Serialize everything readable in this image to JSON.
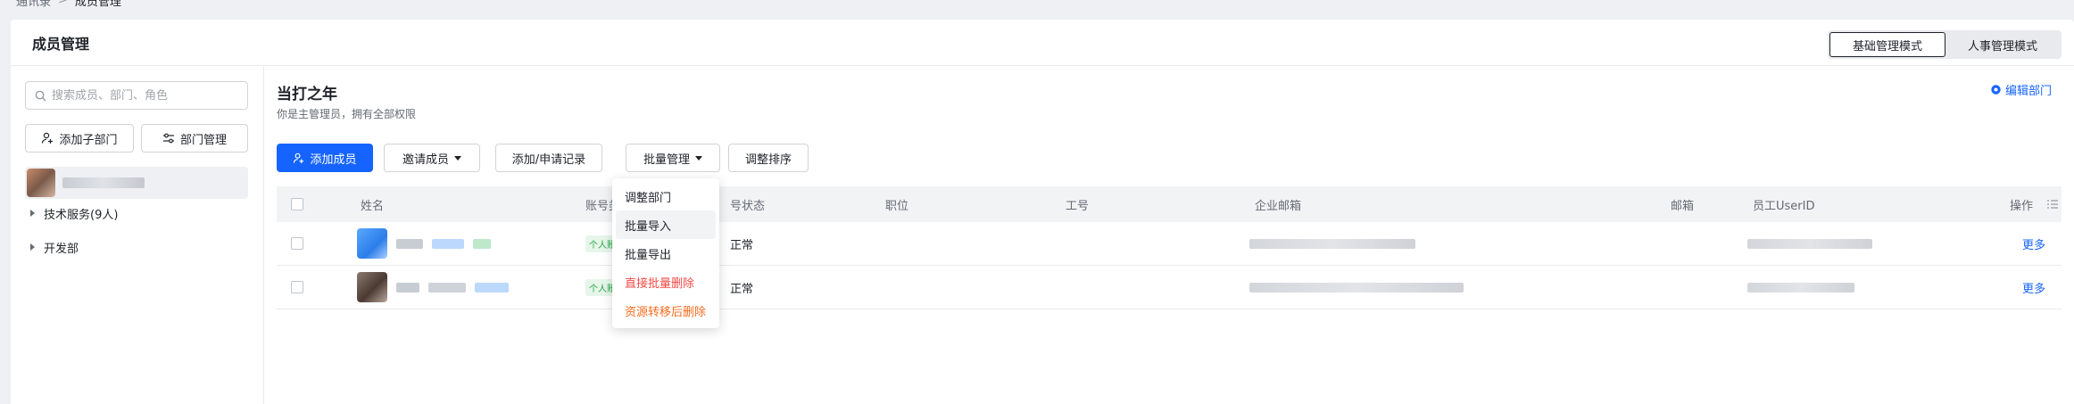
{
  "breadcrumb": {
    "parent": "通讯录",
    "separator": ">",
    "current": "成员管理"
  },
  "panel": {
    "title": "成员管理"
  },
  "mode_switch": {
    "basic": "基础管理模式",
    "hr": "人事管理模式",
    "active": "basic"
  },
  "sidebar": {
    "search_placeholder": "搜索成员、部门、角色",
    "add_sub_dept": "添加子部门",
    "dept_manage": "部门管理",
    "root_name_blurred": "",
    "items": [
      {
        "label": "技术服务(9人)"
      },
      {
        "label": "开发部"
      }
    ]
  },
  "org": {
    "title": "当打之年",
    "subtitle": "你是主管理员，拥有全部权限",
    "edit_dept": "编辑部门"
  },
  "toolbar": {
    "add_member": "添加成员",
    "invite_member": "邀请成员",
    "add_apply_record": "添加/申请记录",
    "batch_manage": "批量管理",
    "adjust_order": "调整排序"
  },
  "table": {
    "columns": [
      "姓名",
      "账号类",
      "号状态",
      "职位",
      "工号",
      "企业邮箱",
      "邮箱",
      "员工UserID",
      "操作"
    ],
    "rows": [
      {
        "badge": "个人账号",
        "status": "正常",
        "action": "更多"
      },
      {
        "badge": "个人账号",
        "status": "正常",
        "action": "更多"
      }
    ]
  },
  "dropdown": {
    "items": [
      {
        "label": "调整部门",
        "kind": "normal"
      },
      {
        "label": "批量导入",
        "kind": "hover"
      },
      {
        "label": "批量导出",
        "kind": "normal"
      },
      {
        "label": "直接批量删除",
        "kind": "danger"
      },
      {
        "label": "资源转移后删除",
        "kind": "warn"
      }
    ]
  },
  "colors": {
    "primary": "#1664ff",
    "danger": "#f54a45",
    "warn": "#f76c1e",
    "badge_green": "#27a844"
  }
}
